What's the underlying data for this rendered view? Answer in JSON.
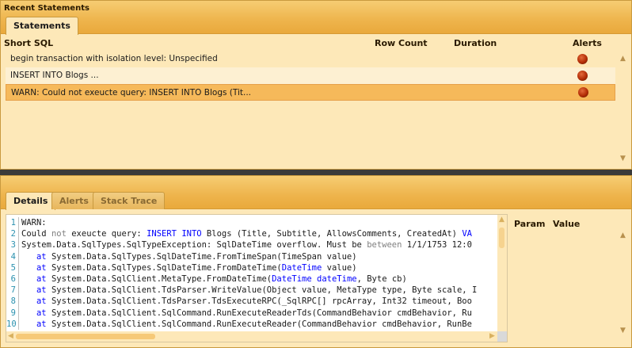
{
  "statements_panel": {
    "title": "Recent Statements",
    "tab": "Statements",
    "columns": [
      "Short SQL",
      "Row Count",
      "Duration",
      "Alerts"
    ],
    "rows": [
      {
        "short_sql": "begin transaction with isolation level: Unspecified",
        "has_alert": true,
        "selected": false
      },
      {
        "short_sql": "INSERT INTO Blogs ...",
        "has_alert": true,
        "selected": false
      },
      {
        "short_sql": "WARN: Could not exeucte query: INSERT INTO Blogs (Tit...",
        "has_alert": true,
        "selected": true
      }
    ]
  },
  "details_panel": {
    "tabs": [
      "Details",
      "Alerts",
      "Stack Trace"
    ],
    "active_tab": "Details",
    "param_columns": [
      "Param",
      "Value"
    ],
    "code_lines": [
      {
        "n": "1",
        "parts": [
          {
            "t": "WARN:",
            "c": "txt"
          }
        ]
      },
      {
        "n": "2",
        "parts": [
          {
            "t": "Could ",
            "c": "txt"
          },
          {
            "t": "not",
            "c": "gr"
          },
          {
            "t": " exeucte query: ",
            "c": "txt"
          },
          {
            "t": "INSERT INTO",
            "c": "kw"
          },
          {
            "t": " Blogs (Title, Subtitle, AllowsComments, CreatedAt) ",
            "c": "txt"
          },
          {
            "t": "VA",
            "c": "kw"
          }
        ]
      },
      {
        "n": "3",
        "parts": [
          {
            "t": "System.Data.SqlTypes.SqlTypeException: SqlDateTime overflow. Must be ",
            "c": "txt"
          },
          {
            "t": "between",
            "c": "gr"
          },
          {
            "t": " 1/1/1753 12:0",
            "c": "txt"
          }
        ]
      },
      {
        "n": "4",
        "parts": [
          {
            "t": "   ",
            "c": "txt"
          },
          {
            "t": "at",
            "c": "kw"
          },
          {
            "t": " System.Data.SqlTypes.SqlDateTime.FromTimeSpan(TimeSpan value)",
            "c": "txt"
          }
        ]
      },
      {
        "n": "5",
        "parts": [
          {
            "t": "   ",
            "c": "txt"
          },
          {
            "t": "at",
            "c": "kw"
          },
          {
            "t": " System.Data.SqlTypes.SqlDateTime.FromDateTime(",
            "c": "txt"
          },
          {
            "t": "DateTime",
            "c": "kw"
          },
          {
            "t": " value)",
            "c": "txt"
          }
        ]
      },
      {
        "n": "6",
        "parts": [
          {
            "t": "   ",
            "c": "txt"
          },
          {
            "t": "at",
            "c": "kw"
          },
          {
            "t": " System.Data.SqlClient.MetaType.FromDateTime(",
            "c": "txt"
          },
          {
            "t": "DateTime",
            "c": "kw"
          },
          {
            "t": " ",
            "c": "txt"
          },
          {
            "t": "dateTime",
            "c": "kw"
          },
          {
            "t": ", Byte cb)",
            "c": "txt"
          }
        ]
      },
      {
        "n": "7",
        "parts": [
          {
            "t": "   ",
            "c": "txt"
          },
          {
            "t": "at",
            "c": "kw"
          },
          {
            "t": " System.Data.SqlClient.TdsParser.WriteValue(Object value, MetaType type, Byte scale, I",
            "c": "txt"
          }
        ]
      },
      {
        "n": "8",
        "parts": [
          {
            "t": "   ",
            "c": "txt"
          },
          {
            "t": "at",
            "c": "kw"
          },
          {
            "t": " System.Data.SqlClient.TdsParser.TdsExecuteRPC(_SqlRPC[] rpcArray, Int32 timeout, Boo",
            "c": "txt"
          }
        ]
      },
      {
        "n": "9",
        "parts": [
          {
            "t": "   ",
            "c": "txt"
          },
          {
            "t": "at",
            "c": "kw"
          },
          {
            "t": " System.Data.SqlClient.SqlCommand.RunExecuteReaderTds(CommandBehavior cmdBehavior, Ru",
            "c": "txt"
          }
        ]
      },
      {
        "n": "10",
        "parts": [
          {
            "t": "   ",
            "c": "txt"
          },
          {
            "t": "at",
            "c": "kw"
          },
          {
            "t": " System.Data.SqlClient.SqlCommand.RunExecuteReader(CommandBehavior cmdBehavior, RunBe",
            "c": "txt"
          }
        ]
      }
    ]
  },
  "icons": {
    "alert": "alert-dot-icon",
    "scroll_up": "scroll-up-arrow-icon",
    "scroll_down": "scroll-down-arrow-icon",
    "scroll_left": "scroll-left-arrow-icon",
    "scroll_right": "scroll-right-arrow-icon"
  },
  "colors": {
    "panel_bg": "#fde8b8",
    "header_gradient_top": "#f6cd73",
    "header_gradient_bottom": "#e9a93c",
    "selected_row": "#f6b95a",
    "alert_dot": "#b22d06",
    "keyword": "#0000ff"
  }
}
